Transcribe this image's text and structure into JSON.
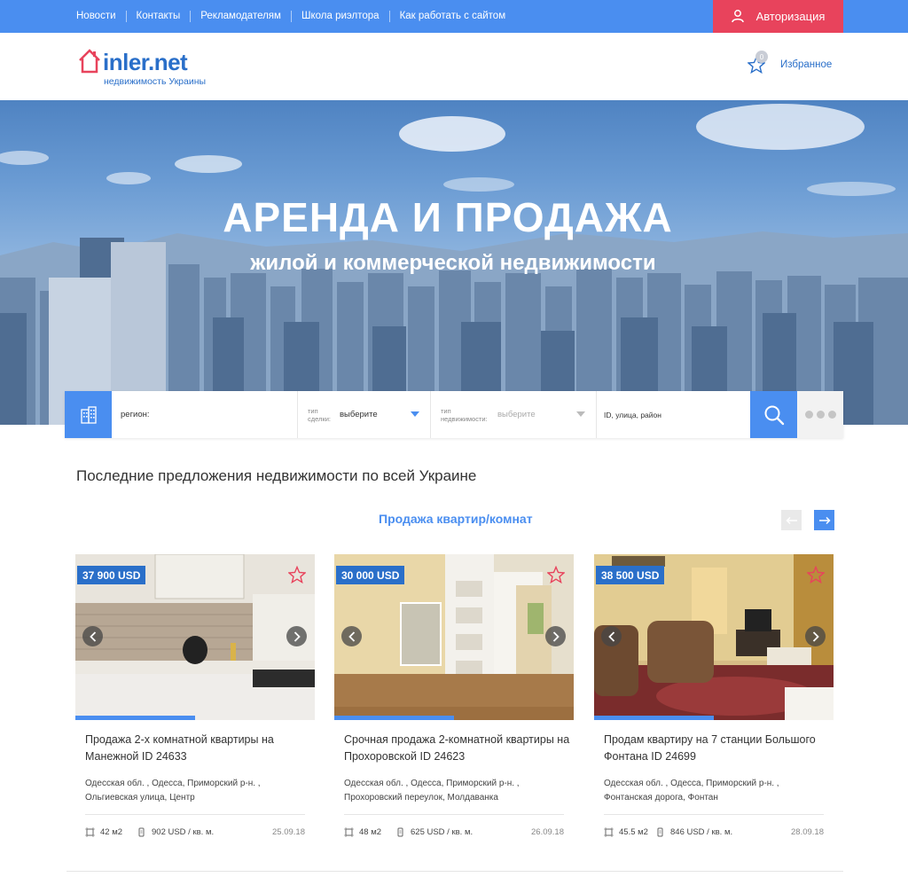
{
  "topnav": {
    "links": [
      "Новости",
      "Контакты",
      "Рекламодателям",
      "Школа риэлтора",
      "Как работать с сайтом"
    ],
    "auth_label": "Авторизация"
  },
  "header": {
    "logo_text": "inler.net",
    "logo_sub": "недвижимость Украины",
    "fav_count": "0",
    "fav_label": "Избранное"
  },
  "hero": {
    "title": "АРЕНДА И ПРОДАЖА",
    "subtitle": "жилой и коммерческой недвижимости"
  },
  "search": {
    "region_label": "регион:",
    "deal_small": "тип сделки:",
    "deal_value": "выберите",
    "prop_small": "тип недвижимости:",
    "prop_value": "выберите",
    "id_label": "ID, улица, район"
  },
  "section": {
    "title": "Последние предложения недвижимости по всей Украине",
    "tab": "Продажа квартир/комнат"
  },
  "colors": {
    "accent": "#4a8ef0",
    "auth": "#e8435c",
    "price_badge": "#2a6fc9"
  },
  "cards": [
    {
      "price": "37 900 USD",
      "title": "Продажа 2-х комнатной квартиры на Манежной ID 24633",
      "addr": "Одесская обл. , Одесса, Приморский р-н. , Ольгиевская улица, Центр",
      "area": "42 м2",
      "ppm": "902 USD / кв. м.",
      "date": "25.09.18",
      "progress": 0.5
    },
    {
      "price": "30 000 USD",
      "title": "Срочная продажа 2-комнатной квартиры на Прохоровской ID 24623",
      "addr": "Одесская обл. , Одесса, Приморский р-н. , Прохоровский переулок, Молдаванка",
      "area": "48 м2",
      "ppm": "625 USD / кв. м.",
      "date": "26.09.18",
      "progress": 0.5
    },
    {
      "price": "38 500 USD",
      "title": "Продам квартиру на 7 станции Большого Фонтана ID 24699",
      "addr": "Одесская обл. , Одесса, Приморский р-н. , Фонтанская дорога, Фонтан",
      "area": "45.5 м2",
      "ppm": "846 USD / кв. м.",
      "date": "28.09.18",
      "progress": 0.5
    }
  ]
}
